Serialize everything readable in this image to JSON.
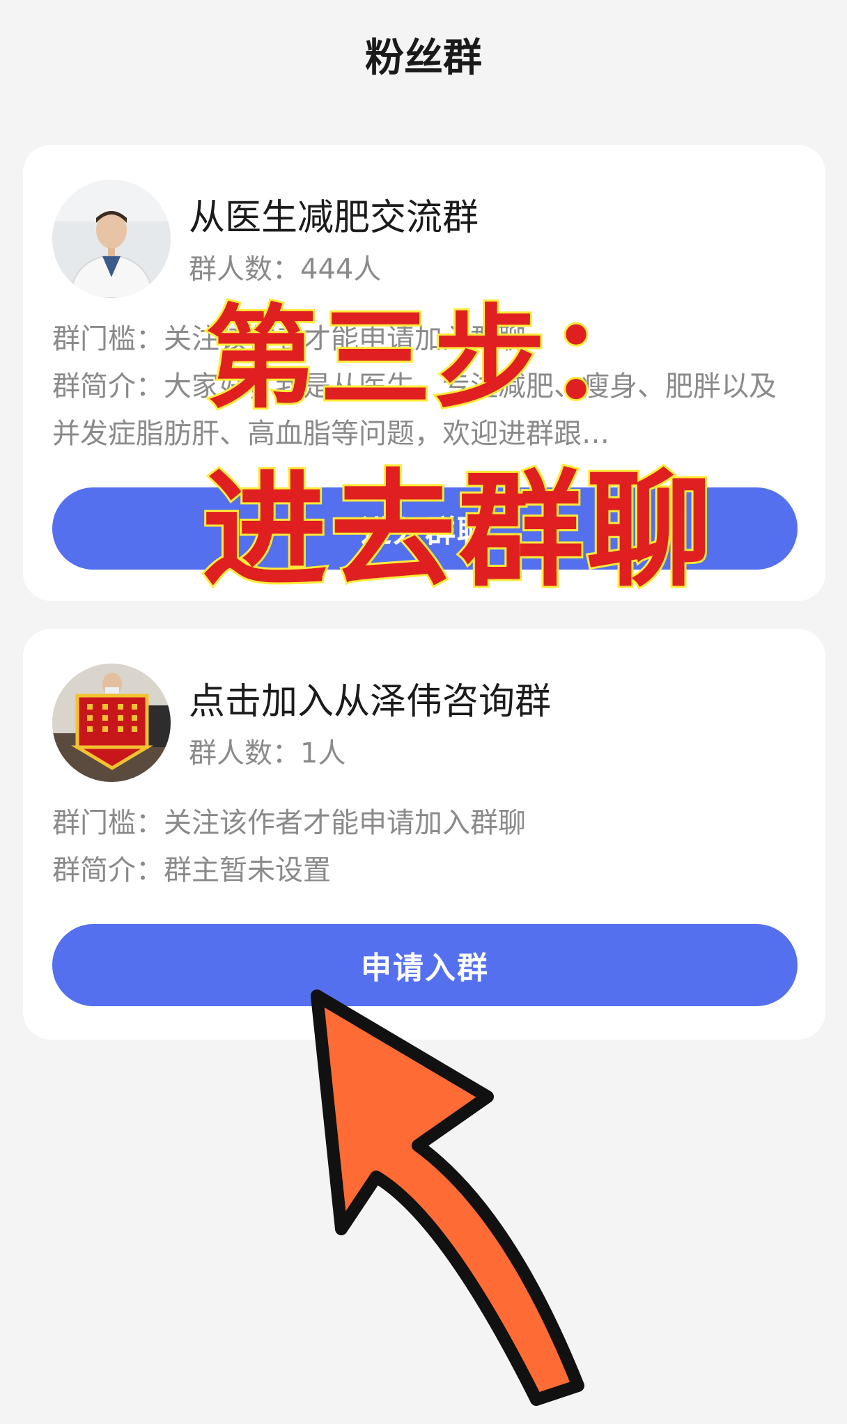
{
  "header": {
    "title": "粉丝群"
  },
  "groups": [
    {
      "name": "从医生减肥交流群",
      "member_count": "群人数：444人",
      "threshold": "群门槛：关注该作者才能申请加入群聊",
      "intro": "群简介：大家好，我是从医生，专注减肥、瘦身、肥胖以及并发症脂肪肝、高血脂等问题，欢迎进群跟…",
      "button_label": "进入群聊"
    },
    {
      "name": "点击加入从泽伟咨询群",
      "member_count": "群人数：1人",
      "threshold": "群门槛：关注该作者才能申请加入群聊",
      "intro": "群简介：群主暂未设置",
      "button_label": "申请入群"
    }
  ],
  "overlay": {
    "line1": "第三步：",
    "line2": "进去群聊"
  },
  "colors": {
    "accent": "#5470ee",
    "overlay_text": "#e02020",
    "overlay_stroke": "#ffeb3b",
    "arrow": "#ff6b35"
  },
  "icons": {
    "arrow": "curved-arrow-up-icon"
  }
}
